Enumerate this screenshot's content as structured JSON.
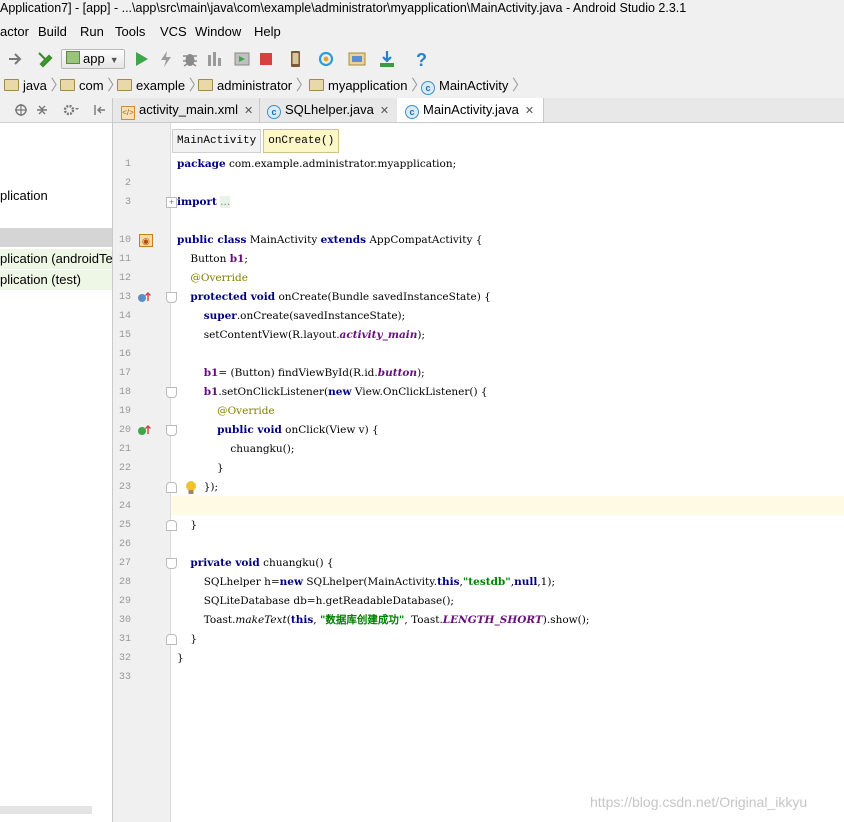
{
  "window": {
    "title": "Application7] - [app] - ...\\app\\src\\main\\java\\com\\example\\administrator\\myapplication\\MainActivity.java - Android Studio 2.3.1"
  },
  "menu": [
    "actor",
    "Build",
    "Run",
    "Tools",
    "VCS",
    "Window",
    "Help"
  ],
  "toolbar": {
    "run_config": "app"
  },
  "breadcrumbs": [
    "java",
    "com",
    "example",
    "administrator",
    "myapplication",
    "MainActivity"
  ],
  "project_tree": {
    "items": [
      "plication",
      "plication (androidTe",
      "plication (test)"
    ]
  },
  "tabs": [
    "activity_main.xml",
    "SQLhelper.java",
    "MainActivity.java"
  ],
  "structure_crumbs": [
    "MainActivity",
    "onCreate()"
  ],
  "code": {
    "line_numbers": [
      "1",
      "2",
      "3",
      "10",
      "11",
      "12",
      "13",
      "14",
      "15",
      "16",
      "17",
      "18",
      "19",
      "20",
      "21",
      "22",
      "23",
      "24",
      "25",
      "26",
      "27",
      "28",
      "29",
      "30",
      "31",
      "32",
      "33"
    ]
  },
  "watermark": "https://blog.csdn.net/Original_ikkyu"
}
